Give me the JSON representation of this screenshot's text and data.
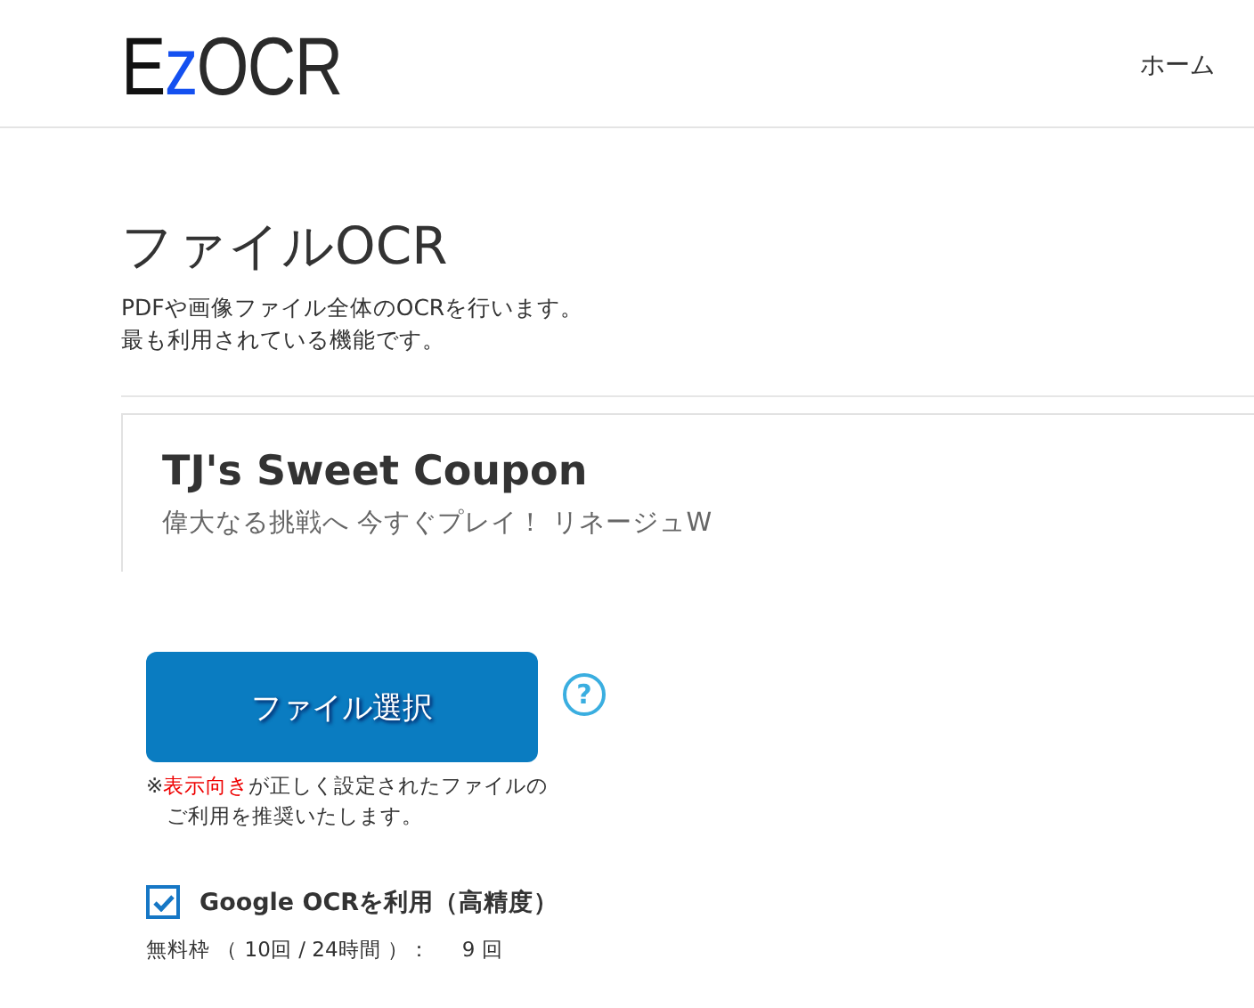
{
  "header": {
    "logo": [
      {
        "text": "E",
        "color": "#111111"
      },
      {
        "text": "z",
        "color": "#1450f0"
      },
      {
        "text": "OCR",
        "color": "#2a2a2a"
      }
    ],
    "nav": [
      "ホーム"
    ]
  },
  "page": {
    "title": "ファイルOCR",
    "description": [
      "PDFや画像ファイル全体のOCRを行います。",
      "最も利用されている機能です。"
    ]
  },
  "ad": {
    "title": "TJ's Sweet Coupon",
    "text": "偉大なる挑戦へ 今すぐプレイ！ リネージュW"
  },
  "upload": {
    "button": "ファイル選択",
    "help_icon": "?",
    "note": [
      {
        "text": "※",
        "emphasis": false
      },
      {
        "text": "表示向き",
        "emphasis": true
      },
      {
        "text": "が正しく設定されたファイルのご利用を推奨いたします。",
        "emphasis": false
      }
    ]
  },
  "google_ocr": {
    "label": "Google OCRを利用（高精度）",
    "checked": true
  },
  "quota": {
    "label": "無料枠 （ 10回 / 24時間 ）：",
    "value": "9 回"
  }
}
